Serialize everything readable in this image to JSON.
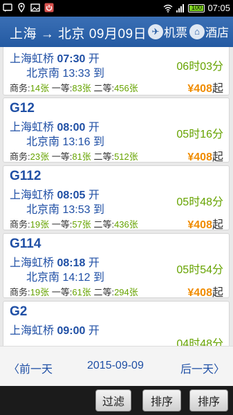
{
  "status_bar": {
    "time": "07:05",
    "battery": "100"
  },
  "header": {
    "route": "上海 → 北京 09月09日",
    "ticket_label": "机票",
    "hotel_label": "酒店"
  },
  "trains": [
    {
      "no": "",
      "dep_station": "上海虹桥",
      "dep_time": "07:30",
      "dep_suffix": "开",
      "arr_station": "北京南",
      "arr_time": "13:33",
      "arr_suffix": "到",
      "duration": "06时03分",
      "seats": [
        {
          "label": "商务:",
          "count": "14张"
        },
        {
          "label": "一等:",
          "count": "83张"
        },
        {
          "label": "二等:",
          "count": "456张"
        }
      ],
      "price_symbol": "¥",
      "price": "408",
      "price_suffix": "起"
    },
    {
      "no": "G12",
      "dep_station": "上海虹桥",
      "dep_time": "08:00",
      "dep_suffix": "开",
      "arr_station": "北京南",
      "arr_time": "13:16",
      "arr_suffix": "到",
      "duration": "05时16分",
      "seats": [
        {
          "label": "商务:",
          "count": "23张"
        },
        {
          "label": "一等:",
          "count": "81张"
        },
        {
          "label": "二等:",
          "count": "512张"
        }
      ],
      "price_symbol": "¥",
      "price": "408",
      "price_suffix": "起"
    },
    {
      "no": "G112",
      "dep_station": "上海虹桥",
      "dep_time": "08:05",
      "dep_suffix": "开",
      "arr_station": "北京南",
      "arr_time": "13:53",
      "arr_suffix": "到",
      "duration": "05时48分",
      "seats": [
        {
          "label": "商务:",
          "count": "19张"
        },
        {
          "label": "一等:",
          "count": "57张"
        },
        {
          "label": "二等:",
          "count": "436张"
        }
      ],
      "price_symbol": "¥",
      "price": "408",
      "price_suffix": "起"
    },
    {
      "no": "G114",
      "dep_station": "上海虹桥",
      "dep_time": "08:18",
      "dep_suffix": "开",
      "arr_station": "北京南",
      "arr_time": "14:12",
      "arr_suffix": "到",
      "duration": "05时54分",
      "seats": [
        {
          "label": "商务:",
          "count": "19张"
        },
        {
          "label": "一等:",
          "count": "61张"
        },
        {
          "label": "二等:",
          "count": "294张"
        }
      ],
      "price_symbol": "¥",
      "price": "408",
      "price_suffix": "起"
    },
    {
      "no": "G2",
      "dep_station": "上海虹桥",
      "dep_time": "09:00",
      "dep_suffix": "开",
      "arr_station": "",
      "arr_time": "",
      "arr_suffix": "",
      "duration": "04时48分",
      "seats": [],
      "price_symbol": "",
      "price": "",
      "price_suffix": ""
    }
  ],
  "date_nav": {
    "prev_label": "前一天",
    "current_date": "2015-09-09",
    "next_label": "后一天"
  },
  "toolbar": {
    "filter_label": "过滤",
    "sort1_label": "排序",
    "sort2_label": "排序"
  },
  "colors": {
    "header": "#245aa2",
    "train_text": "#1f4fa5",
    "duration": "#66a300",
    "price": "#f08c00"
  }
}
